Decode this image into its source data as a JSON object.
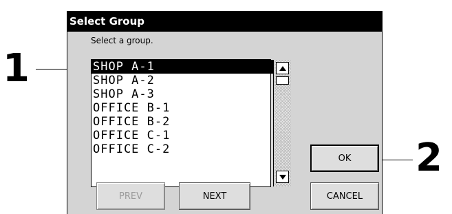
{
  "callouts": {
    "one": "1",
    "two": "2"
  },
  "dialog": {
    "title": "Select Group",
    "prompt": "Select a group.",
    "list": {
      "items": [
        "SHOP A-1",
        "SHOP A-2",
        "SHOP A-3",
        "OFFICE B-1",
        "OFFICE B-2",
        "OFFICE C-1",
        "OFFICE C-2"
      ],
      "selected_index": 0
    },
    "buttons": {
      "prev": "PREV",
      "next": "NEXT",
      "ok": "OK",
      "cancel": "CANCEL"
    }
  },
  "icons": {
    "scroll_up": "scroll-up-arrow",
    "scroll_down": "scroll-down-arrow"
  }
}
